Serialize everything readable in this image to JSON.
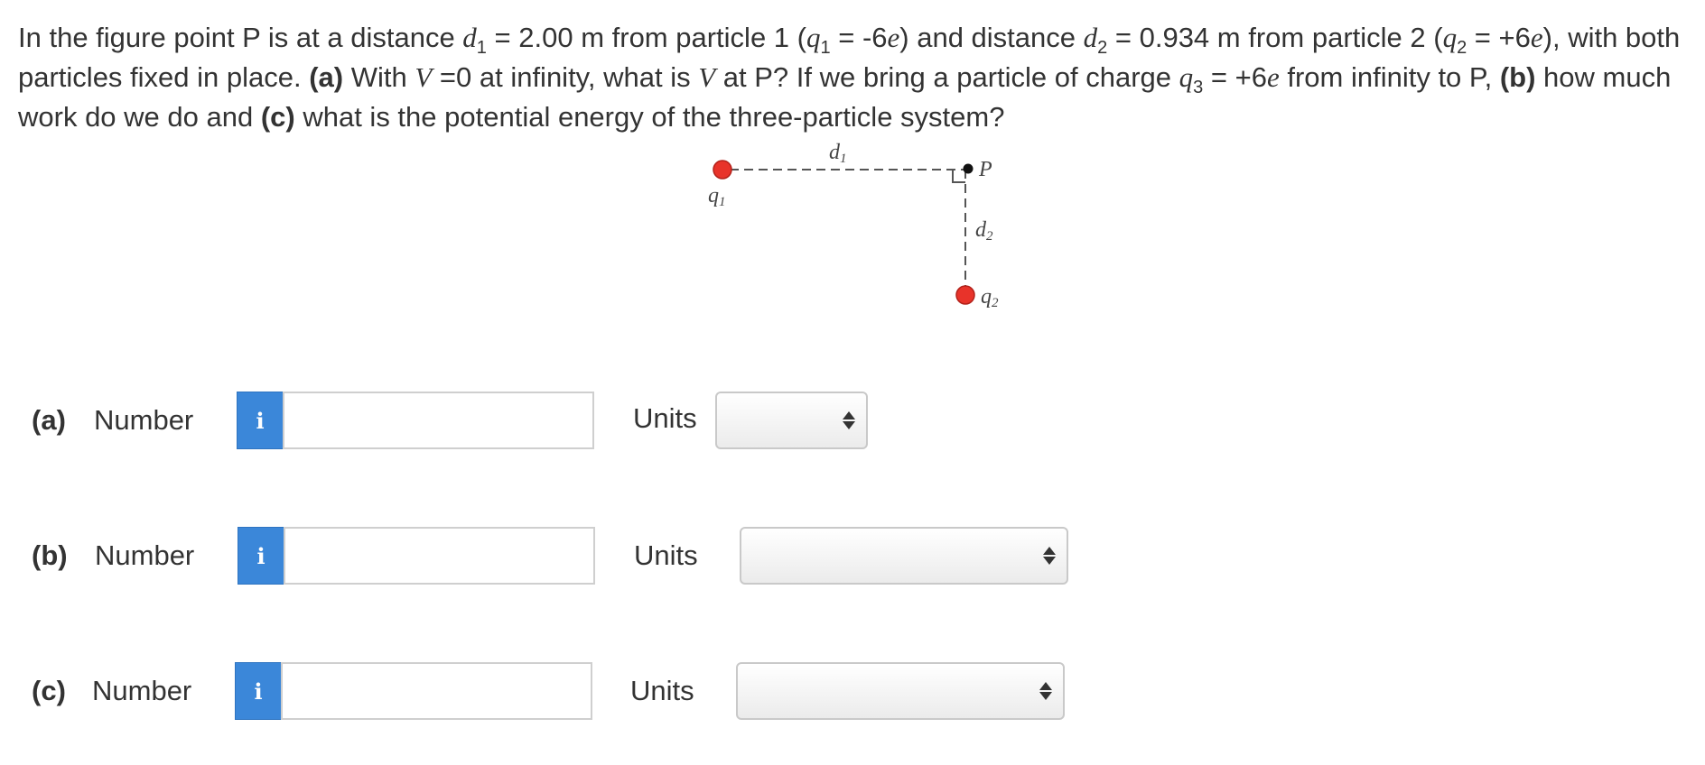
{
  "question": {
    "s1": "In the figure point P is at a distance ",
    "d1_sym": "d",
    "d1_sub": "1",
    "s2": " = 2.00 m from particle 1 (",
    "q1_sym": "q",
    "q1_sub": "1",
    "s3": " = -6",
    "e1": "e",
    "s4": ") and distance ",
    "d2_sym": "d",
    "d2_sub": "2",
    "s5": " = 0.934 m from particle 2 (",
    "q2_sym": "q",
    "q2_sub": "2",
    "s6": " = +6",
    "e2": "e",
    "s7": "), with both particles fixed in place. ",
    "pa": "(a)",
    "s8": " With ",
    "v1": "V",
    "s9": " =0 at infinity, what is ",
    "v2": "V",
    "s10": " at P? If we bring a particle of charge ",
    "q3_sym": "q",
    "q3_sub": "3",
    "s11": " = +6",
    "e3": "e",
    "s12": " from infinity to P, ",
    "pb": "(b)",
    "s13": " how much work do we do and ",
    "pc": "(c)",
    "s14": " what is the potential energy of the three-particle system?"
  },
  "figure": {
    "d1_label": "d",
    "d1_sub": "1",
    "d2_label": "d",
    "d2_sub": "2",
    "q1_label": "q",
    "q1_sub": "1",
    "q2_label": "q",
    "q2_sub": "2",
    "p_label": "P",
    "particle_color": "#e8332a"
  },
  "answers": [
    {
      "part": "(a)",
      "number_label": "Number",
      "info_icon": "i",
      "value": "",
      "units_label": "Units",
      "units_value": ""
    },
    {
      "part": "(b)",
      "number_label": "Number",
      "info_icon": "i",
      "value": "",
      "units_label": "Units",
      "units_value": ""
    },
    {
      "part": "(c)",
      "number_label": "Number",
      "info_icon": "i",
      "value": "",
      "units_label": "Units",
      "units_value": ""
    }
  ]
}
